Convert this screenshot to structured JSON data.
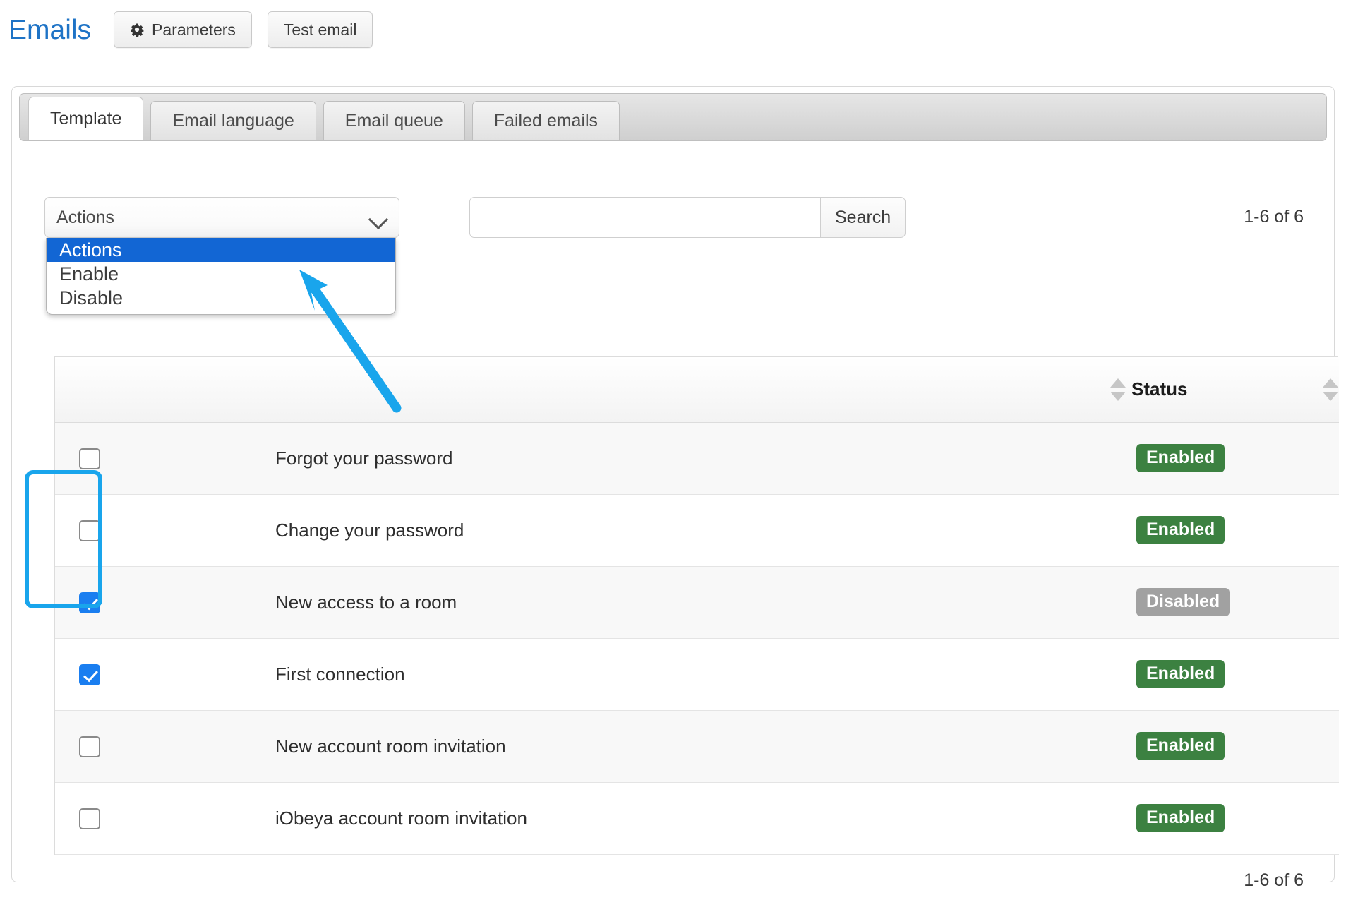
{
  "header": {
    "title": "Emails",
    "buttons": [
      {
        "label": "Parameters",
        "icon": "gear-icon",
        "glyph": "⚙"
      },
      {
        "label": "Test email",
        "icon": null,
        "glyph": ""
      }
    ]
  },
  "tabs": [
    {
      "label": "Template",
      "active": true
    },
    {
      "label": "Email language",
      "active": false
    },
    {
      "label": "Email queue",
      "active": false
    },
    {
      "label": "Failed emails",
      "active": false
    }
  ],
  "toolbar": {
    "actions_select": {
      "selected": "Actions",
      "expanded": true,
      "options": [
        "Actions",
        "Enable",
        "Disable"
      ],
      "highlighted_option": "Actions"
    },
    "search": {
      "value": "",
      "placeholder": "",
      "button_label": "Search"
    },
    "count_top": "1-6 of 6"
  },
  "table": {
    "columns": [
      {
        "key": "check",
        "label": "",
        "sortable": false
      },
      {
        "key": "name",
        "label": "",
        "sortable": true
      },
      {
        "key": "status",
        "label": "Status",
        "sortable": true
      }
    ],
    "rows": [
      {
        "checked": false,
        "name": "Forgot your password",
        "status": "Enabled",
        "status_kind": "enabled"
      },
      {
        "checked": false,
        "name": "Change your password",
        "status": "Enabled",
        "status_kind": "enabled"
      },
      {
        "checked": true,
        "name": "New access to a room",
        "status": "Disabled",
        "status_kind": "disabled"
      },
      {
        "checked": true,
        "name": "First connection",
        "status": "Enabled",
        "status_kind": "enabled"
      },
      {
        "checked": false,
        "name": "New account room invitation",
        "status": "Enabled",
        "status_kind": "enabled"
      },
      {
        "checked": false,
        "name": "iObeya account room invitation",
        "status": "Enabled",
        "status_kind": "enabled"
      }
    ]
  },
  "footer": {
    "count_bottom": "1-6 of 6"
  },
  "annotations": {
    "highlight_color": "#19a5ec",
    "arrow_color": "#19a5ec",
    "highlight_target": "selected-row-checkboxes",
    "arrow_target": "actions-dropdown-list"
  },
  "colors": {
    "title_blue": "#1e73c6",
    "enabled_green": "#3c8141",
    "disabled_gray": "#a1a1a1",
    "dropdown_select_blue": "#1266d4",
    "checkbox_blue": "#1a7ef0"
  }
}
